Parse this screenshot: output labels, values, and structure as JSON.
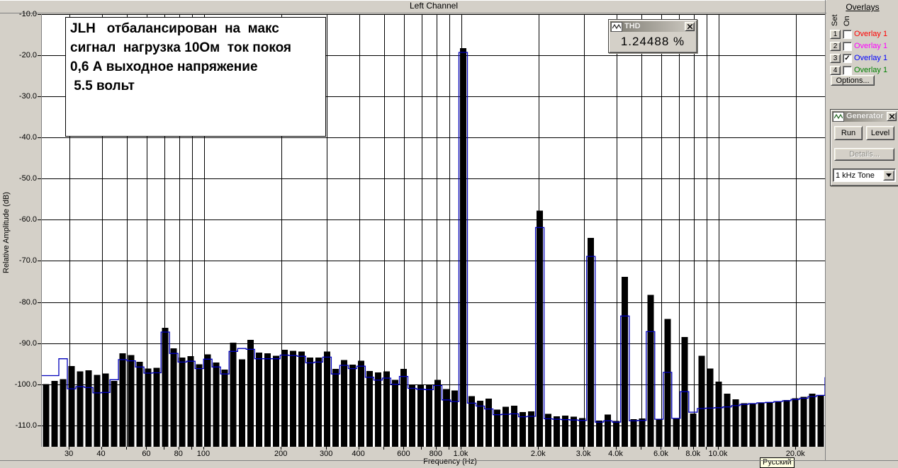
{
  "window": {
    "title": "Left Channel",
    "bottom_tooltip": "Русский"
  },
  "axes": {
    "x_label": "Frequency (Hz)",
    "y_label": "Relative Amplitude (dB)"
  },
  "annotation": {
    "lines": [
      "JLH   отбалансирован  на  макс",
      "сигнал  нагрузка 10Ом  ток покоя",
      "0,6 А выходное напряжение",
      " 5.5 вольт"
    ]
  },
  "thd_window": {
    "title": "THD",
    "value": "1.24488 %"
  },
  "overlays_panel": {
    "title": "Overlays",
    "col_set": "Set",
    "col_on": "On",
    "rows": [
      {
        "button": "1",
        "label": "Overlay 1",
        "color": "#ff0000",
        "checked": false
      },
      {
        "button": "2",
        "label": "Overlay 1",
        "color": "#ff00ff",
        "checked": false
      },
      {
        "button": "3",
        "label": "Overlay 1",
        "color": "#0000ff",
        "checked": true
      },
      {
        "button": "4",
        "label": "Overlay 1",
        "color": "#008000",
        "checked": false
      }
    ],
    "options_button": "Options..."
  },
  "generator_window": {
    "title": "Generator",
    "run_button": "Run",
    "level_button": "Level",
    "details_button": "Details...",
    "signal_select": "1 kHz Tone"
  },
  "chart_data": {
    "type": "bar",
    "title": "Left Channel",
    "xlabel": "Frequency (Hz)",
    "ylabel": "Relative Amplitude (dB)",
    "x_scale": "log",
    "freq_range_hz": [
      23.4,
      25900
    ],
    "ylim_db": [
      -115.2,
      -10
    ],
    "grid": true,
    "y_ticks": [
      -10,
      -20,
      -30,
      -40,
      -50,
      -60,
      -70,
      -80,
      -90,
      -100,
      -110
    ],
    "y_tick_labels": [
      "-10.0",
      "-20.0",
      "-30.0",
      "-40.0",
      "-50.0",
      "-60.0",
      "-70.0",
      "-80.0",
      "-90.0",
      "-100.0",
      "-110.0"
    ],
    "x_gridlines_hz": [
      30,
      40,
      50,
      60,
      70,
      80,
      90,
      100,
      200,
      300,
      400,
      500,
      600,
      700,
      800,
      900,
      1000,
      2000,
      3000,
      4000,
      5000,
      6000,
      7000,
      8000,
      9000,
      10000,
      20000
    ],
    "x_tick_labels": [
      {
        "hz": 30,
        "label": "30"
      },
      {
        "hz": 40,
        "label": "40"
      },
      {
        "hz": 60,
        "label": "60"
      },
      {
        "hz": 80,
        "label": "80"
      },
      {
        "hz": 100,
        "label": "100"
      },
      {
        "hz": 200,
        "label": "200"
      },
      {
        "hz": 300,
        "label": "300"
      },
      {
        "hz": 400,
        "label": "400"
      },
      {
        "hz": 600,
        "label": "600"
      },
      {
        "hz": 800,
        "label": "800"
      },
      {
        "hz": 1000,
        "label": "1.0k"
      },
      {
        "hz": 2000,
        "label": "2.0k"
      },
      {
        "hz": 3000,
        "label": "3.0k"
      },
      {
        "hz": 4000,
        "label": "4.0k"
      },
      {
        "hz": 6000,
        "label": "6.0k"
      },
      {
        "hz": 8000,
        "label": "8.0k"
      },
      {
        "hz": 10000,
        "label": "10.0k"
      },
      {
        "hz": 20000,
        "label": "20.0k"
      }
    ],
    "bar_count": 92,
    "thd_percent": 1.24488,
    "fundamental": {
      "hz": 1000,
      "db": -18.3
    },
    "series": [
      {
        "name": "current-spectrum",
        "style": "filled-bar",
        "color": "#000000",
        "values_db": [
          -100.0,
          -99.2,
          -98.8,
          -95.6,
          -96.9,
          -96.6,
          -97.7,
          -97.4,
          -99.2,
          -92.5,
          -92.9,
          -94.5,
          -96.2,
          -96.0,
          -86.3,
          -91.3,
          -93.5,
          -93.2,
          -95.1,
          -92.7,
          -94.7,
          -96.4,
          -89.9,
          -93.9,
          -89.2,
          -92.3,
          -92.5,
          -93.1,
          -91.6,
          -91.9,
          -92.0,
          -93.5,
          -93.5,
          -92.0,
          -96.3,
          -94.1,
          -95.2,
          -94.3,
          -96.8,
          -97.1,
          -96.9,
          -98.9,
          -96.3,
          -100.2,
          -100.1,
          -100.2,
          -98.9,
          -101.2,
          -101.5,
          -18.3,
          -102.9,
          -104.0,
          -103.5,
          -106.2,
          -105.5,
          -105.2,
          -106.8,
          -106.6,
          -57.8,
          -107.2,
          -107.8,
          -107.6,
          -107.9,
          -108.2,
          -64.4,
          -108.8,
          -107.4,
          -108.9,
          -73.9,
          -108.5,
          -108.3,
          -78.3,
          -108.6,
          -84.1,
          -108.2,
          -88.5,
          -107.1,
          -93.1,
          -96.2,
          -99.4,
          -102.3,
          -103.7,
          -104.6,
          -104.6,
          -104.4,
          -104.4,
          -104.1,
          -103.8,
          -103.4,
          -103.1,
          -102.3,
          -102.6
        ]
      },
      {
        "name": "overlay-1-blue",
        "style": "step-line",
        "color": "#0000bb",
        "values_db": [
          -97.9,
          -97.9,
          -93.8,
          -101.1,
          -100.6,
          -100.8,
          -102.1,
          -102.0,
          -98.9,
          -94.0,
          -94.3,
          -95.8,
          -97.3,
          -97.2,
          -87.3,
          -92.5,
          -94.6,
          -94.4,
          -96.2,
          -93.9,
          -95.8,
          -97.5,
          -92.0,
          -91.3,
          -91.5,
          -93.8,
          -93.8,
          -93.8,
          -92.9,
          -93.0,
          -93.2,
          -94.8,
          -94.6,
          -93.4,
          -97.5,
          -95.4,
          -96.2,
          -95.6,
          -98.3,
          -99.0,
          -98.5,
          -100.0,
          -98.1,
          -101.0,
          -101.2,
          -101.3,
          -100.3,
          -103.8,
          -104.2,
          -19.3,
          -104.6,
          -105.3,
          -106.0,
          -107.4,
          -107.3,
          -107.2,
          -107.9,
          -107.8,
          -61.9,
          -108.4,
          -108.5,
          -108.6,
          -108.7,
          -108.8,
          -68.9,
          -109.2,
          -108.9,
          -109.2,
          -83.4,
          -108.9,
          -108.8,
          -87.2,
          -108.5,
          -97.1,
          -108.3,
          -101.8,
          -106.8,
          -105.9,
          -105.8,
          -105.7,
          -105.5,
          -105.2,
          -104.9,
          -104.7,
          -104.5,
          -104.4,
          -104.2,
          -104.0,
          -103.7,
          -103.4,
          -103.0,
          -102.7,
          -98.4
        ]
      }
    ]
  }
}
